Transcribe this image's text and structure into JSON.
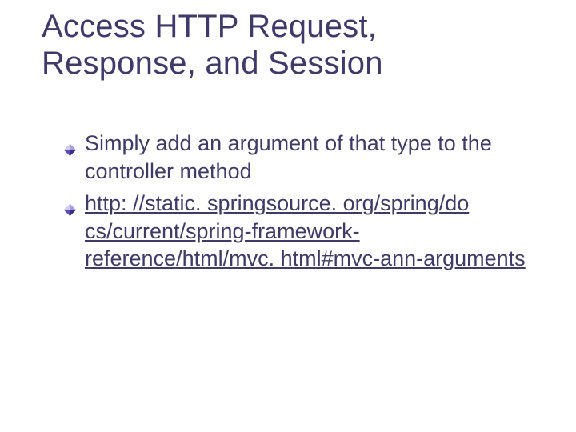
{
  "title": "Access HTTP Request, Response, and Session",
  "bullets": {
    "b1": "Simply add an argument of that type to the controller method",
    "b2": "http: //static. springsource. org/spring/do cs/current/spring-framework-reference/html/mvc. html#mvc-ann-arguments"
  }
}
